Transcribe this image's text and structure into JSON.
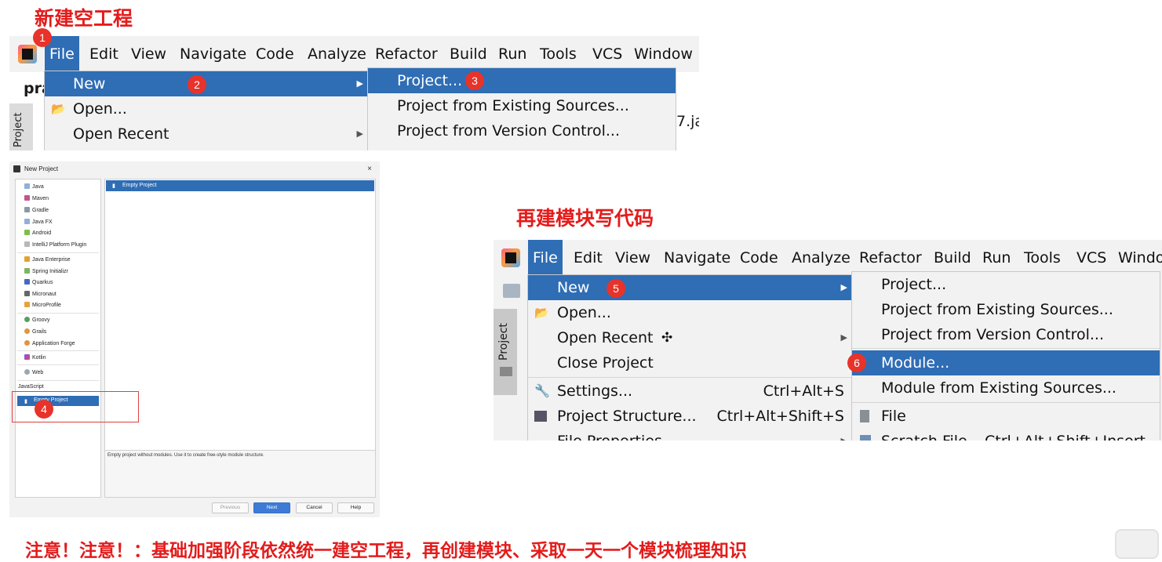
{
  "heading_top": "新建空工程",
  "heading_mid": "再建模块写代码",
  "footer_note": "注意！注意！：基础加强阶段依然统一建空工程，再创建模块、采取一天一个模块梳理知识",
  "colors": {
    "heading_red": "#e31c1c",
    "menu_blue": "#2f6db5",
    "badge_red": "#e8332a"
  },
  "badges": [
    "1",
    "2",
    "3",
    "4",
    "5",
    "6"
  ],
  "menubar1": {
    "items": [
      "File",
      "Edit",
      "View",
      "Navigate",
      "Code",
      "Analyze",
      "Refactor",
      "Build",
      "Run",
      "Tools",
      "VCS",
      "Window"
    ],
    "bg_text_left": "pra",
    "bg_text_right": "7.ja",
    "side_tab": "Project"
  },
  "file_menu1": {
    "items": [
      "New",
      "Open...",
      "Open Recent"
    ]
  },
  "new_submenu1": {
    "items": [
      "Project...",
      "Project from Existing Sources...",
      "Project from Version Control..."
    ]
  },
  "dialog": {
    "title": "New Project",
    "close": "×",
    "left_items": [
      "Java",
      "Maven",
      "Gradle",
      "Java FX",
      "Android",
      "IntelliJ Platform Plugin",
      "Java Enterprise",
      "Spring Initializr",
      "Quarkus",
      "Micronaut",
      "MicroProfile",
      "Groovy",
      "Grails",
      "Application Forge",
      "Kotlin",
      "Web",
      "JavaScript",
      "Empty Project"
    ],
    "selected_template": "Empty Project",
    "description": "Empty project without modules. Use it to create free-style module structure.",
    "buttons": {
      "previous": "Previous",
      "next": "Next",
      "cancel": "Cancel",
      "help": "Help"
    }
  },
  "menubar2": {
    "items": [
      "File",
      "Edit",
      "View",
      "Navigate",
      "Code",
      "Analyze",
      "Refactor",
      "Build",
      "Run",
      "Tools",
      "VCS",
      "Windo"
    ],
    "side_tab": "Project"
  },
  "file_menu2": {
    "items": [
      {
        "label": "New",
        "shortcut": ""
      },
      {
        "label": "Open...",
        "shortcut": ""
      },
      {
        "label": "Open Recent",
        "shortcut": ""
      },
      {
        "label": "Close Project",
        "shortcut": ""
      },
      {
        "label": "Settings...",
        "shortcut": "Ctrl+Alt+S"
      },
      {
        "label": "Project Structure...",
        "shortcut": "Ctrl+Alt+Shift+S"
      },
      {
        "label": "File Properties",
        "shortcut": ""
      }
    ]
  },
  "new_submenu2": {
    "items": [
      "Project...",
      "Project from Existing Sources...",
      "Project from Version Control...",
      "Module...",
      "Module from Existing Sources...",
      "File",
      "Scratch File"
    ],
    "scratch_shortcut": "Ctrl+Alt+Shift+Insert"
  }
}
